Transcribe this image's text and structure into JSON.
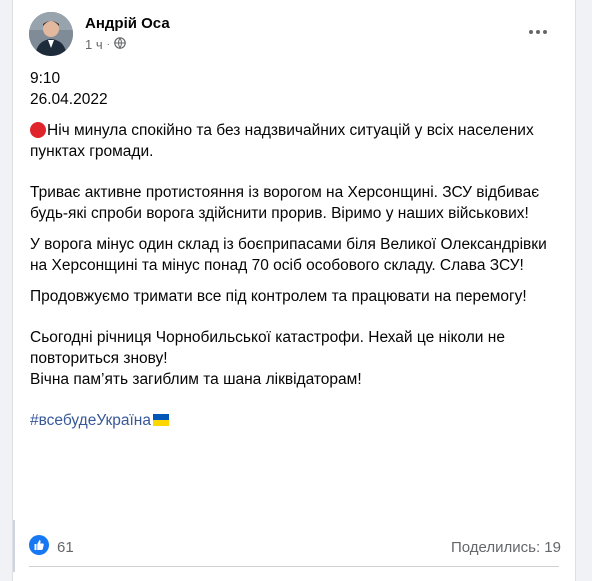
{
  "post": {
    "author_name": "Андрій Оса",
    "time_ago": "1 ч",
    "privacy_icon": "globe-icon",
    "more_icon": "more-options-icon",
    "time": "9:10",
    "date": "26.04.2022",
    "red_dot_icon": "red-circle-icon",
    "p1": "Ніч минула спокійно та без надзвичайних ситуацій у всіх населених пунктах громади.",
    "p2": "Триває активне протистояння із ворогом на Херсонщині. ЗСУ відбиває будь-які спроби ворога здійснити прорив. Віримо у наших військових!",
    "p3": "У ворога мінус один склад із боєприпасами біля Великої Олександрівки на Херсонщині та мінус понад 70 осіб особового складу. Слава ЗСУ!",
    "p4": "Продовжуємо тримати все під контролем та працювати на перемогу!",
    "p5a": "Сьогодні річниця Чорнобильської катастрофи. Нехай це ніколи не повториться знову!",
    "p5b": "Вічна пам’ять загиблим та шана ліквідаторам!",
    "hashtag": "#всебудеУкраїна",
    "flag_icon": "ukraine-flag-icon"
  },
  "footer": {
    "like_icon": "like-reaction-icon",
    "reaction_count": "61",
    "shares_text": "Поделились: 19"
  },
  "colors": {
    "link": "#385898",
    "muted": "#65676b",
    "like_blue": "#1877f2",
    "red_dot": "#e0242b"
  }
}
